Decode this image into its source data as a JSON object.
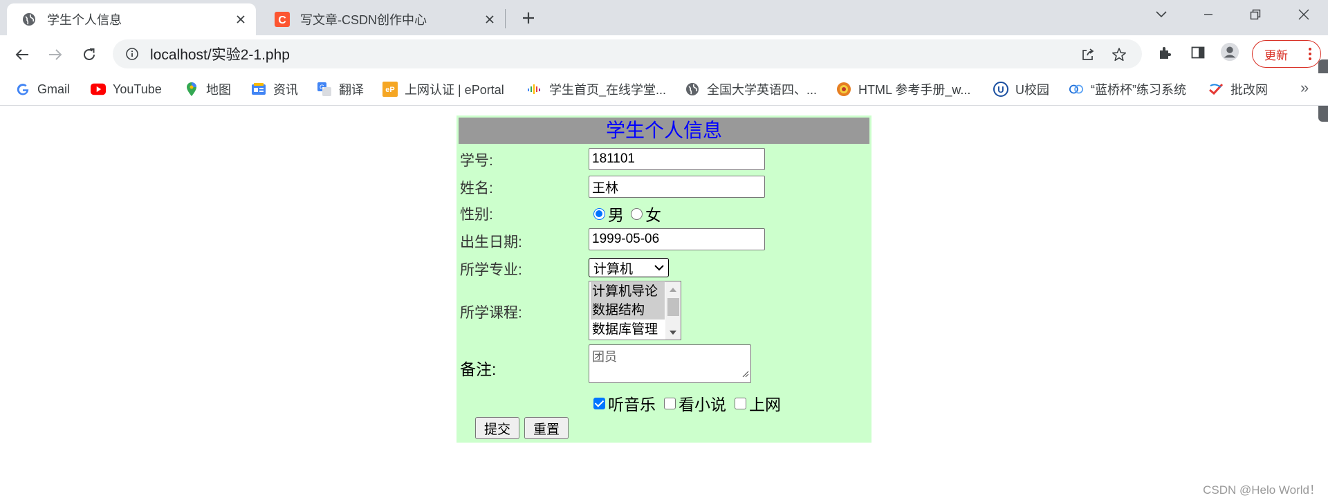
{
  "browser": {
    "tabs": [
      {
        "title": "学生个人信息",
        "active": true,
        "icon": "globe-icon"
      },
      {
        "title": "写文章-CSDN创作中心",
        "active": false,
        "icon": "csdn-icon"
      }
    ],
    "url": "localhost/实验2-1.php",
    "update_label": "更新",
    "bookmarks": [
      {
        "label": "Gmail",
        "icon": "google-icon"
      },
      {
        "label": "YouTube",
        "icon": "youtube-icon"
      },
      {
        "label": "地图",
        "icon": "maps-icon"
      },
      {
        "label": "资讯",
        "icon": "news-icon"
      },
      {
        "label": "翻译",
        "icon": "translate-icon"
      },
      {
        "label": "上网认证 | ePortal",
        "icon": "eportal-icon"
      },
      {
        "label": "学生首页_在线学堂...",
        "icon": "xuetang-icon"
      },
      {
        "label": "全国大学英语四、...",
        "icon": "globe-icon"
      },
      {
        "label": "HTML 参考手册_w...",
        "icon": "w3-icon"
      },
      {
        "label": "U校园",
        "icon": "u-icon"
      },
      {
        "label": "“蓝桥杯”练习系统",
        "icon": "lanqiao-icon"
      },
      {
        "label": "批改网",
        "icon": "pigai-icon"
      }
    ]
  },
  "form": {
    "title": "学生个人信息",
    "student_id": {
      "label": "学号:",
      "value": "181101"
    },
    "name": {
      "label": "姓名:",
      "value": "王林"
    },
    "gender": {
      "label": "性别:",
      "options": [
        "男",
        "女"
      ],
      "selected": "男"
    },
    "birthdate": {
      "label": "出生日期:",
      "value": "1999-05-06"
    },
    "major": {
      "label": "所学专业:",
      "selected": "计算机"
    },
    "courses": {
      "label": "所学课程:",
      "options": [
        "计算机导论",
        "数据结构",
        "数据库管理"
      ],
      "selected": [
        "计算机导论",
        "数据结构"
      ]
    },
    "remarks": {
      "label": "备注:",
      "value": "团员"
    },
    "hobbies": [
      {
        "label": "听音乐",
        "checked": true
      },
      {
        "label": "看小说",
        "checked": false
      },
      {
        "label": "上网",
        "checked": false
      }
    ],
    "submit_label": "提交",
    "reset_label": "重置"
  },
  "watermark": "CSDN @Helo World！",
  "colors": {
    "form_bg": "#ccffcc",
    "header_bg": "#999999",
    "header_text": "#0000ff",
    "accent": "#0075ff",
    "update_red": "#d93025"
  }
}
